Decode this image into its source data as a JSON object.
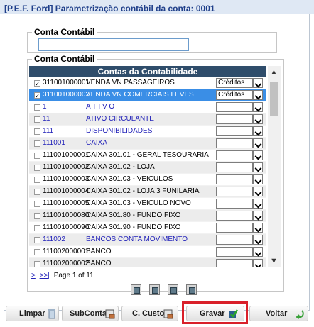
{
  "window": {
    "title": "[P.E.F. Ford] Parametrização contábil da conta: 0001"
  },
  "filter": {
    "legend": "Conta Contábil",
    "value": ""
  },
  "list": {
    "legend": "Conta Contábil",
    "header": "Contas da Contabilidade",
    "rows": [
      {
        "code": "311001000001",
        "desc": "VENDA VN PASSAGEIROS",
        "checked": true,
        "select": "Créditos",
        "style": "normal"
      },
      {
        "code": "311001000002",
        "desc": "VENDA VN COMERCIAIS LEVES",
        "checked": true,
        "select": "Créditos",
        "style": "selected"
      },
      {
        "code": "1",
        "desc": "A T I V O",
        "checked": false,
        "select": "",
        "style": "blue"
      },
      {
        "code": "11",
        "desc": "ATIVO CIRCULANTE",
        "checked": false,
        "select": "",
        "style": "blue"
      },
      {
        "code": "111",
        "desc": "DISPONIBILIDADES",
        "checked": false,
        "select": "",
        "style": "blue"
      },
      {
        "code": "111001",
        "desc": "CAIXA",
        "checked": false,
        "select": "",
        "style": "blue"
      },
      {
        "code": "111001000001",
        "desc": "CAIXA 301.01 - GERAL TESOURARIA",
        "checked": false,
        "select": "",
        "style": "normal"
      },
      {
        "code": "111001000002",
        "desc": "CAIXA 301.02 - LOJA",
        "checked": false,
        "select": "",
        "style": "normal"
      },
      {
        "code": "111001000003",
        "desc": "CAIXA 301.03 - VEICULOS",
        "checked": false,
        "select": "",
        "style": "normal"
      },
      {
        "code": "111001000004",
        "desc": "CAIXA 301.02 - LOJA 3 FUNILARIA",
        "checked": false,
        "select": "",
        "style": "normal"
      },
      {
        "code": "111001000005",
        "desc": "CAIXA 301.03 - VEICULO NOVO",
        "checked": false,
        "select": "",
        "style": "normal"
      },
      {
        "code": "111001000080",
        "desc": "CAIXA 301.80 - FUNDO FIXO",
        "checked": false,
        "select": "",
        "style": "normal"
      },
      {
        "code": "111001000090",
        "desc": "CAIXA 301.90 - FUNDO FIXO",
        "checked": false,
        "select": "",
        "style": "normal"
      },
      {
        "code": "111002",
        "desc": "BANCOS CONTA MOVIMENTO",
        "checked": false,
        "select": "",
        "style": "blue"
      },
      {
        "code": "111002000001",
        "desc": "BANCO",
        "checked": false,
        "select": "",
        "style": "normal"
      },
      {
        "code": "111002000002",
        "desc": "BANCO",
        "checked": false,
        "select": "",
        "style": "normal"
      }
    ]
  },
  "pager": {
    "next": ">",
    "last": ">>|",
    "text": "Page 1 of 11"
  },
  "buttons": {
    "clear": "Limpar",
    "subaccount": "SubConta",
    "cost_center": "C. Custo",
    "save": "Gravar",
    "back": "Voltar"
  },
  "colors": {
    "highlight": "#d9202a",
    "header": "#2f4d6b",
    "selected_row": "#3a8ee6",
    "parent_account": "#2323b9"
  }
}
